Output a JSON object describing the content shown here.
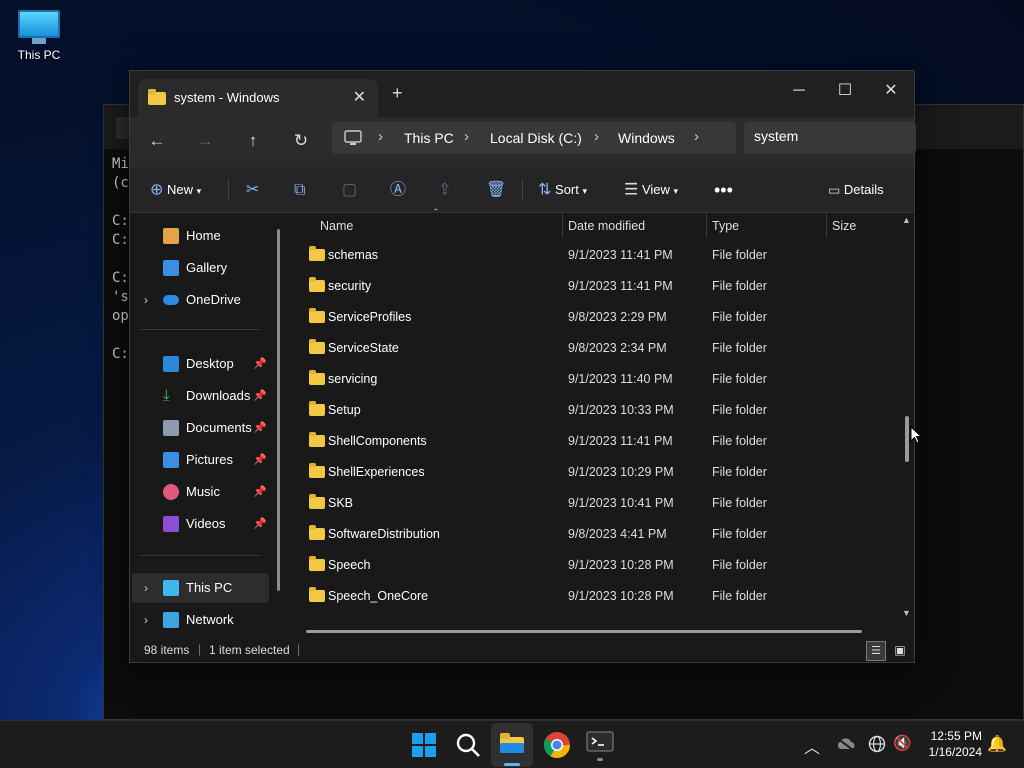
{
  "desktop": {
    "icon_label": "This PC"
  },
  "terminal": {
    "lines": "Mi\n(c\n\nC:\nC:\n\nC:\n's\nop\n\nC:"
  },
  "window": {
    "tab_title": "system - Windows",
    "address": [
      "This PC",
      "Local Disk (C:)",
      "Windows"
    ],
    "search_value": "system"
  },
  "toolbar": {
    "new_label": "New",
    "sort_label": "Sort",
    "view_label": "View",
    "details_label": "Details"
  },
  "nav": {
    "home": "Home",
    "gallery": "Gallery",
    "onedrive": "OneDrive",
    "desktop": "Desktop",
    "downloads": "Downloads",
    "documents": "Documents",
    "pictures": "Pictures",
    "music": "Music",
    "videos": "Videos",
    "thispc": "This PC",
    "network": "Network"
  },
  "columns": {
    "name": "Name",
    "date": "Date modified",
    "type": "Type",
    "size": "Size"
  },
  "rows": [
    {
      "name": "schemas",
      "date": "9/1/2023 11:41 PM",
      "type": "File folder"
    },
    {
      "name": "security",
      "date": "9/1/2023 11:41 PM",
      "type": "File folder"
    },
    {
      "name": "ServiceProfiles",
      "date": "9/8/2023 2:29 PM",
      "type": "File folder"
    },
    {
      "name": "ServiceState",
      "date": "9/8/2023 2:34 PM",
      "type": "File folder"
    },
    {
      "name": "servicing",
      "date": "9/1/2023 11:40 PM",
      "type": "File folder"
    },
    {
      "name": "Setup",
      "date": "9/1/2023 10:33 PM",
      "type": "File folder"
    },
    {
      "name": "ShellComponents",
      "date": "9/1/2023 11:41 PM",
      "type": "File folder"
    },
    {
      "name": "ShellExperiences",
      "date": "9/1/2023 10:29 PM",
      "type": "File folder"
    },
    {
      "name": "SKB",
      "date": "9/1/2023 10:41 PM",
      "type": "File folder"
    },
    {
      "name": "SoftwareDistribution",
      "date": "9/8/2023 4:41 PM",
      "type": "File folder"
    },
    {
      "name": "Speech",
      "date": "9/1/2023 10:28 PM",
      "type": "File folder"
    },
    {
      "name": "Speech_OneCore",
      "date": "9/1/2023 10:28 PM",
      "type": "File folder"
    }
  ],
  "status": {
    "items": "98 items",
    "selected": "1 item selected"
  },
  "clock": {
    "time": "12:55 PM",
    "date": "1/16/2024"
  }
}
